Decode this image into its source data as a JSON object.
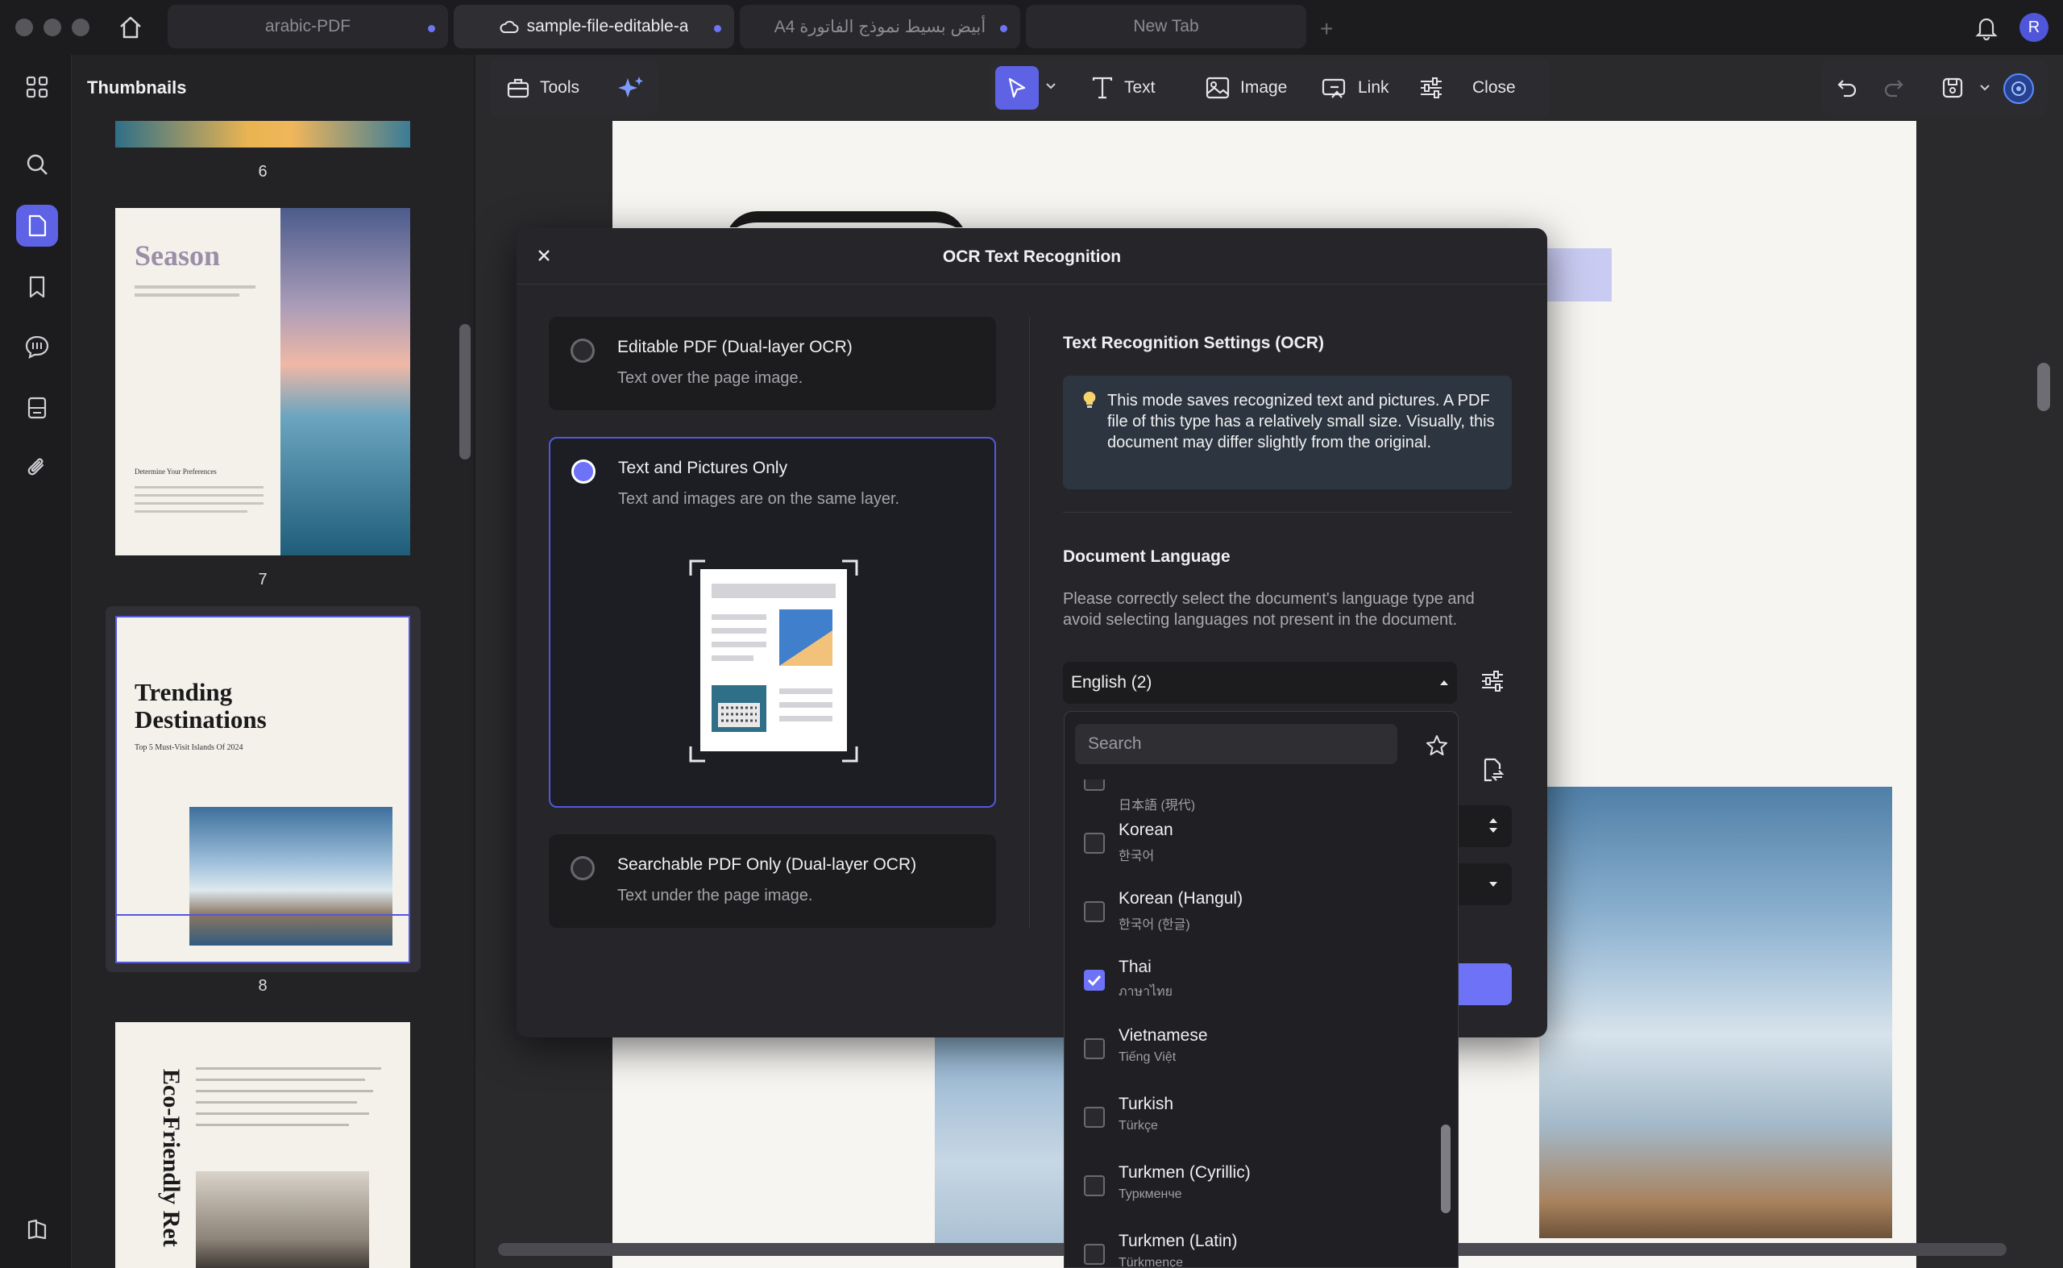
{
  "tabs": [
    {
      "label": "arabic-PDF"
    },
    {
      "label": "sample-file-editable-a"
    },
    {
      "label": "A4 أبيض بسيط نموذج الفاتورة"
    },
    {
      "label": "New Tab"
    }
  ],
  "profile_initial": "R",
  "sidebar_title": "Thumbnails",
  "thumbnails": [
    {
      "page": "6"
    },
    {
      "page": "7",
      "title": "Season",
      "subtitle": "Determine Your Preferences"
    },
    {
      "page": "8",
      "title": "Trending Destinations",
      "subtitle": "Top 5 Must-Visit Islands Of 2024"
    },
    {
      "title": "Eco-Friendly Ret"
    }
  ],
  "toolbar": {
    "tools": "Tools",
    "text": "Text",
    "image": "Image",
    "link": "Link",
    "close": "Close"
  },
  "dialog": {
    "title": "OCR Text Recognition",
    "modes": [
      {
        "title": "Editable PDF (Dual-layer OCR)",
        "desc": "Text over the page image.",
        "selected": false
      },
      {
        "title": "Text and Pictures Only",
        "desc": "Text and images are on the same layer.",
        "selected": true
      },
      {
        "title": "Searchable PDF Only (Dual-layer OCR)",
        "desc": "Text under the page image.",
        "selected": false
      }
    ],
    "settings_title": "Text Recognition Settings (OCR)",
    "info": "This mode saves recognized text and pictures. A PDF file of this type has a relatively small size. Visually, this document may differ slightly from the original.",
    "doc_lang_title": "Document Language",
    "doc_lang_desc": "Please correctly select the document's language type and avoid selecting languages not present in the document.",
    "selected_lang": "English (2)"
  },
  "dropdown": {
    "search_placeholder": "Search",
    "partial_native": "日本語 (現代)",
    "languages": [
      {
        "name": "Korean",
        "native": "한국어",
        "checked": false
      },
      {
        "name": "Korean (Hangul)",
        "native": "한국어 (한글)",
        "checked": false
      },
      {
        "name": "Thai",
        "native": "ภาษาไทย",
        "checked": true
      },
      {
        "name": "Vietnamese",
        "native": "Tiếng Việt",
        "checked": false
      },
      {
        "name": "Turkish",
        "native": "Türkçe",
        "checked": false
      },
      {
        "name": "Turkmen (Cyrillic)",
        "native": "Туркменче",
        "checked": false
      },
      {
        "name": "Turkmen (Latin)",
        "native": "Türkmençe",
        "checked": false
      }
    ]
  },
  "colors": {
    "accent": "#6d72f7",
    "background": "#1e1e21",
    "dialog": "#26262a"
  }
}
